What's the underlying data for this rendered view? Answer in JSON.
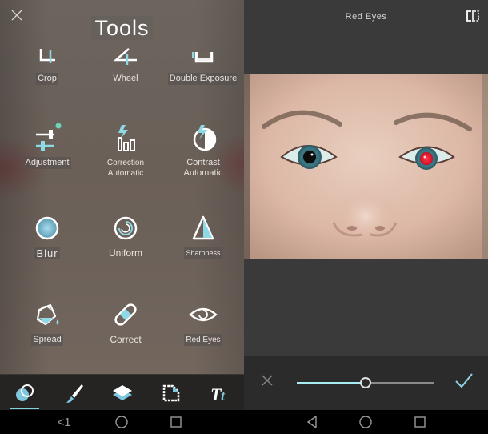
{
  "left_panel": {
    "title": "Tools",
    "close_icon": "close-icon",
    "tools": [
      {
        "label": "Crop",
        "icon": "crop-icon"
      },
      {
        "label": "Wheel",
        "icon": "wheel-icon"
      },
      {
        "label": "Double Exposure",
        "icon": "double-exposure-icon"
      },
      {
        "label": "Adjustment",
        "icon": "adjustment-sliders-icon",
        "badge": true
      },
      {
        "label": "Correction Automatic",
        "line1": "Correction",
        "line2": "Automatic",
        "icon": "auto-correction-icon"
      },
      {
        "label": "Contrast Automatic",
        "line1": "Contrast",
        "line2": "Automatic",
        "icon": "auto-contrast-icon"
      },
      {
        "label": "Blur",
        "icon": "blur-icon"
      },
      {
        "label": "Uniform",
        "icon": "uniform-icon"
      },
      {
        "label": "Sharpness",
        "icon": "sharpness-icon"
      },
      {
        "label": "Spread",
        "icon": "spread-bucket-icon"
      },
      {
        "label": "Correct",
        "icon": "bandage-icon"
      },
      {
        "label": "Red Eyes",
        "icon": "eye-icon"
      }
    ],
    "tabbar": [
      {
        "name": "effects",
        "icon": "circles-icon",
        "active": true
      },
      {
        "name": "brush",
        "icon": "brush-icon",
        "active": false
      },
      {
        "name": "layers",
        "icon": "layers-icon",
        "active": false
      },
      {
        "name": "frames",
        "icon": "frame-icon",
        "active": false
      },
      {
        "name": "text",
        "icon": "text-icon",
        "active": false
      }
    ]
  },
  "right_panel": {
    "title": "Red Eyes",
    "compare_icon": "compare-icon",
    "slider": {
      "value_percent": 50
    },
    "cancel_icon": "close-icon",
    "confirm_icon": "check-icon"
  },
  "colors": {
    "accent": "#7fd1df",
    "panel_dark": "#3a3a3a",
    "control_bar": "#2b2b2b",
    "red_eye": "#e8102a"
  },
  "android_nav": {
    "back": "back-icon",
    "home": "home-icon",
    "recents": "recents-icon"
  }
}
